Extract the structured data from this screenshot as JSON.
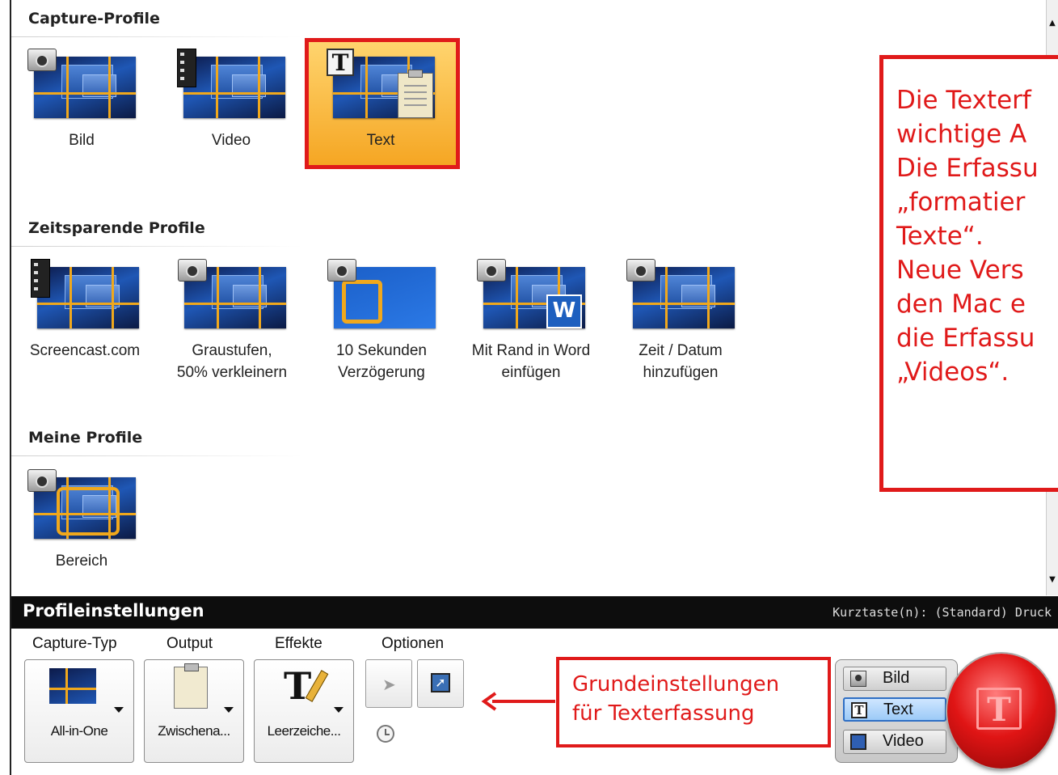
{
  "sections": {
    "capture_profiles": "Capture-Profile",
    "timesaving_profiles": "Zeitsparende Profile",
    "my_profiles": "Meine Profile"
  },
  "capture_profiles": [
    {
      "label": "Bild",
      "icon": "camera-icon"
    },
    {
      "label": "Video",
      "icon": "film-icon"
    },
    {
      "label": "Text",
      "icon": "text-t-icon",
      "selected": true
    }
  ],
  "timesaving_profiles": [
    {
      "label_line1": "Screencast.com",
      "label_line2": ""
    },
    {
      "label_line1": "Graustufen,",
      "label_line2": "50% verkleinern"
    },
    {
      "label_line1": "10 Sekunden",
      "label_line2": "Verzögerung"
    },
    {
      "label_line1": "Mit Rand in Word",
      "label_line2": "einfügen"
    },
    {
      "label_line1": "Zeit / Datum",
      "label_line2": "hinzufügen"
    }
  ],
  "my_profiles": [
    {
      "label": "Bereich"
    }
  ],
  "settings_bar": {
    "title": "Profileinstellungen",
    "hotkey": "Kurztaste(n): (Standard) Druck"
  },
  "settings": {
    "capture_type_label": "Capture-Typ",
    "capture_type_value": "All-in-One",
    "output_label": "Output",
    "output_value": "Zwischena...",
    "effects_label": "Effekte",
    "effects_value": "Leerzeiche...",
    "options_label": "Optionen"
  },
  "modes": [
    {
      "label": "Bild",
      "icon": "camera-icon",
      "active": false
    },
    {
      "label": "Text",
      "icon": "text-t-icon",
      "active": true
    },
    {
      "label": "Video",
      "icon": "film-icon",
      "active": false
    }
  ],
  "callouts": {
    "big_lines": [
      "Die Texterf",
      "wichtige A",
      "Die Erfassu",
      "„formatier",
      "Texte“.",
      "Neue Vers",
      "den Mac e",
      "die Erfassu",
      "„Videos“."
    ],
    "small_lines": [
      "Grundeinstellungen",
      "für Texterfassung"
    ]
  },
  "colors": {
    "highlight_red": "#e01a1a",
    "selection_orange": "#f5a623",
    "grid_orange": "#f0a81c",
    "dark_bar": "#0d0d0d"
  }
}
